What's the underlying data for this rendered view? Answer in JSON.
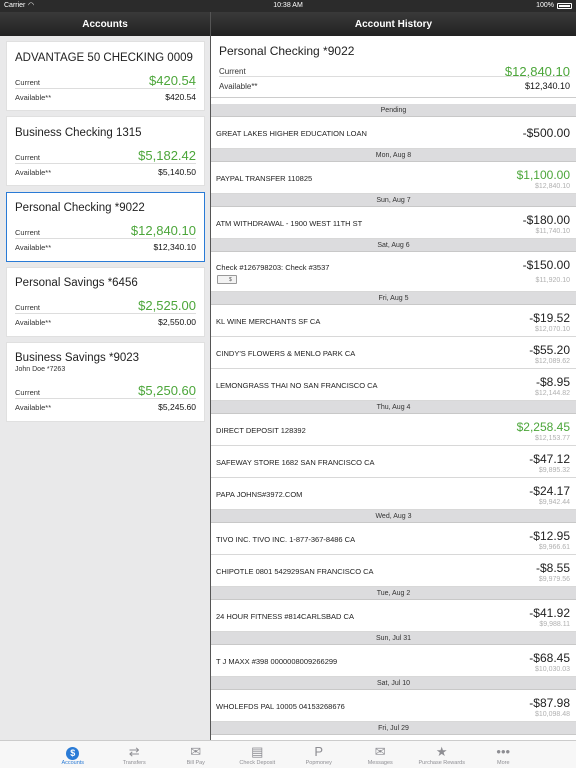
{
  "status_bar": {
    "carrier": "Carrier",
    "time": "10:38 AM",
    "battery": "100%"
  },
  "left_nav": {
    "title": "Accounts"
  },
  "right_nav": {
    "title": "Account History"
  },
  "accounts": [
    {
      "name": "ADVANTAGE 50 CHECKING 0009",
      "sub": "",
      "current_label": "Current",
      "current": "$420.54",
      "available_label": "Available**",
      "available": "$420.54"
    },
    {
      "name": "Business Checking 1315",
      "sub": "",
      "current_label": "Current",
      "current": "$5,182.42",
      "available_label": "Available**",
      "available": "$5,140.50"
    },
    {
      "name": "Personal Checking *9022",
      "sub": "",
      "current_label": "Current",
      "current": "$12,840.10",
      "available_label": "Available**",
      "available": "$12,340.10"
    },
    {
      "name": "Personal Savings *6456",
      "sub": "",
      "current_label": "Current",
      "current": "$2,525.00",
      "available_label": "Available**",
      "available": "$2,550.00"
    },
    {
      "name": "Business Savings *9023",
      "sub": "John Doe *7263",
      "current_label": "Current",
      "current": "$5,250.60",
      "available_label": "Available**",
      "available": "$5,245.60"
    }
  ],
  "summary": {
    "name": "Personal Checking *9022",
    "current_label": "Current",
    "current": "$12,840.10",
    "available_label": "Available**",
    "available": "$12,340.10"
  },
  "history": {
    "pending_header": "Pending",
    "pending": [
      {
        "desc": "GREAT LAKES HIGHER EDUCATION LOAN",
        "amount": "-$500.00"
      }
    ],
    "groups": [
      {
        "date": "Mon, Aug 8",
        "rows": [
          {
            "desc": "PAYPAL TRANSFER 110825",
            "amount": "$1,100.00",
            "balance": "$12,840.10"
          }
        ]
      },
      {
        "date": "Sun, Aug 7",
        "rows": [
          {
            "desc": "ATM WITHDRAWAL - 1900 WEST 11TH ST",
            "amount": "-$180.00",
            "balance": "$11,740.10"
          }
        ]
      },
      {
        "date": "Sat, Aug 6",
        "rows": [
          {
            "desc": "Check #126798203: Check #3537",
            "amount": "-$150.00",
            "balance": "$11,920.10",
            "check_icon": "$"
          }
        ]
      },
      {
        "date": "Fri, Aug 5",
        "rows": [
          {
            "desc": "KL WINE MERCHANTS SF CA",
            "amount": "-$19.52",
            "balance": "$12,070.10"
          },
          {
            "desc": "CINDY'S FLOWERS & MENLO PARK CA",
            "amount": "-$55.20",
            "balance": "$12,089.62"
          },
          {
            "desc": "LEMONGRASS THAI NO SAN FRANCISCO CA",
            "amount": "-$8.95",
            "balance": "$12,144.82"
          }
        ]
      },
      {
        "date": "Thu, Aug 4",
        "rows": [
          {
            "desc": "DIRECT DEPOSIT 128392",
            "amount": "$2,258.45",
            "balance": "$12,153.77"
          },
          {
            "desc": "SAFEWAY STORE 1682 SAN FRANCISCO CA",
            "amount": "-$47.12",
            "balance": "$9,895.32"
          },
          {
            "desc": "PAPA JOHNS#3972.COM",
            "amount": "-$24.17",
            "balance": "$9,942.44"
          }
        ]
      },
      {
        "date": "Wed, Aug 3",
        "rows": [
          {
            "desc": "TIVO INC. TIVO INC. 1-877-367-8486 CA",
            "amount": "-$12.95",
            "balance": "$9,966.61"
          },
          {
            "desc": "CHIPOTLE 0801 542929SAN FRANCISCO CA",
            "amount": "-$8.55",
            "balance": "$9,979.56"
          }
        ]
      },
      {
        "date": "Tue, Aug 2",
        "rows": [
          {
            "desc": "24 HOUR FITNESS #814CARLSBAD CA",
            "amount": "-$41.92",
            "balance": "$9,988.11"
          }
        ]
      },
      {
        "date": "Sun, Jul 31",
        "rows": [
          {
            "desc": "T J MAXX #398 0000008009266299",
            "amount": "-$68.45",
            "balance": "$10,030.03"
          }
        ]
      },
      {
        "date": "Sat, Jul 10",
        "rows": [
          {
            "desc": "WHOLEFDS PAL 10005 04153268676",
            "amount": "-$87.98",
            "balance": "$10,098.48"
          }
        ]
      },
      {
        "date": "Fri, Jul 29",
        "rows": []
      }
    ]
  },
  "tabs": [
    {
      "label": "Accounts",
      "icon": "dollar-icon",
      "glyph": "$",
      "active": true
    },
    {
      "label": "Transfers",
      "icon": "transfer-arrows-icon",
      "glyph": "⇄",
      "active": false
    },
    {
      "label": "Bill Pay",
      "icon": "bill-pay-icon",
      "glyph": "✉",
      "active": false
    },
    {
      "label": "Check Deposit",
      "icon": "check-deposit-icon",
      "glyph": "▤",
      "active": false
    },
    {
      "label": "Popmoney",
      "icon": "popmoney-icon",
      "glyph": "P",
      "active": false
    },
    {
      "label": "Messages",
      "icon": "envelope-icon",
      "glyph": "✉",
      "active": false
    },
    {
      "label": "Purchase Rewards",
      "icon": "star-icon",
      "glyph": "★",
      "active": false
    },
    {
      "label": "More",
      "icon": "more-dots-icon",
      "glyph": "•••",
      "active": false
    }
  ],
  "colors": {
    "accent": "#2a7bd6",
    "positive": "#4ca63a",
    "header_bg": "#dcdcde"
  }
}
